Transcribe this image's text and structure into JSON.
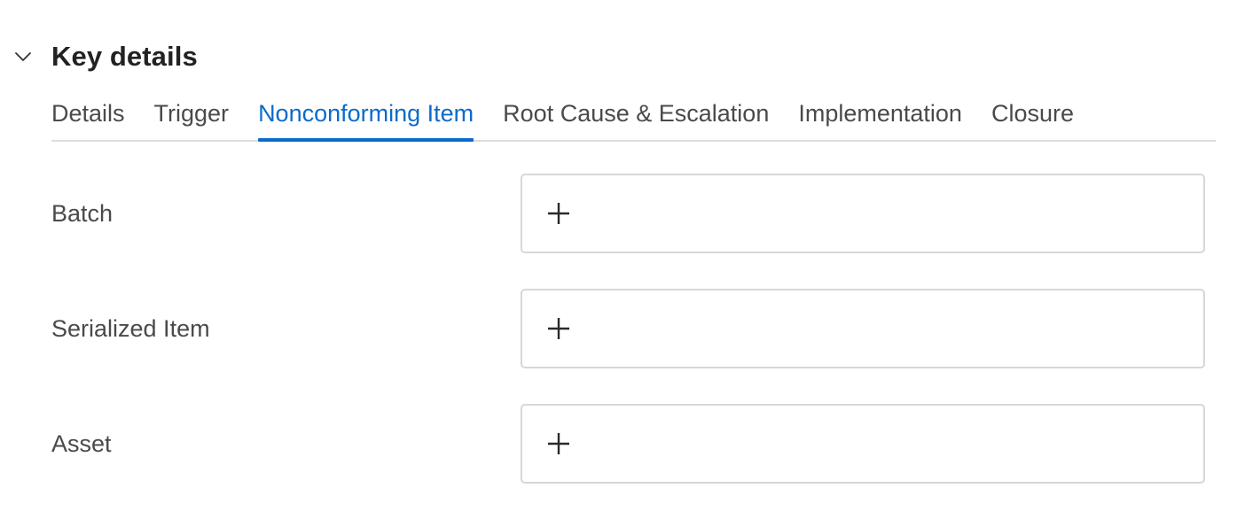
{
  "section": {
    "title": "Key details",
    "collapse_icon": "chevron-down-icon"
  },
  "tabs": [
    {
      "label": "Details",
      "active": false
    },
    {
      "label": "Trigger",
      "active": false
    },
    {
      "label": "Nonconforming Item",
      "active": true
    },
    {
      "label": "Root Cause & Escalation",
      "active": false
    },
    {
      "label": "Implementation",
      "active": false
    },
    {
      "label": "Closure",
      "active": false
    }
  ],
  "fields": [
    {
      "label": "Batch",
      "value": "",
      "action_icon": "plus-icon"
    },
    {
      "label": "Serialized Item",
      "value": "",
      "action_icon": "plus-icon"
    },
    {
      "label": "Asset",
      "value": "",
      "action_icon": "plus-icon"
    }
  ],
  "colors": {
    "accent": "#0b6bcb",
    "text": "#4a4a4a",
    "title": "#222222",
    "border": "#d7d7d7",
    "divider": "#dddddd"
  }
}
